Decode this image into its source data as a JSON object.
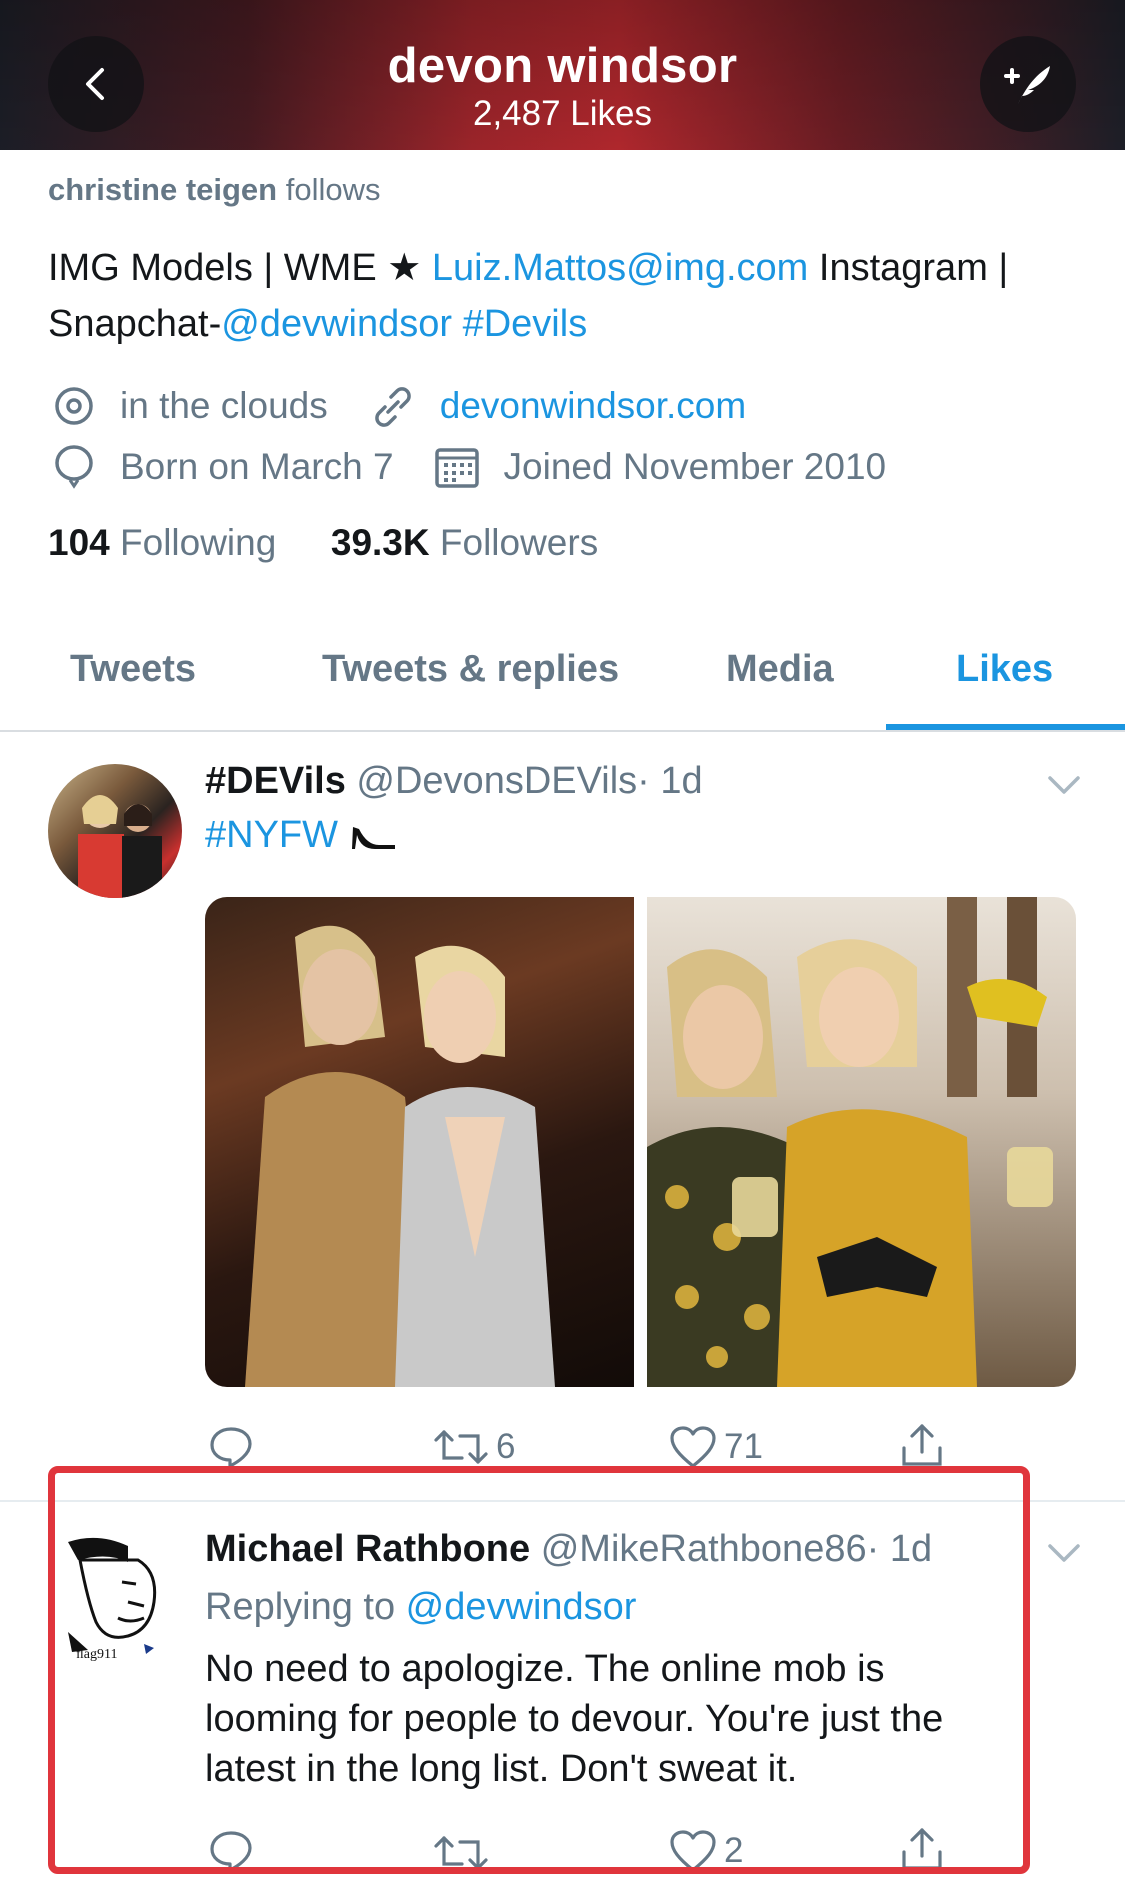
{
  "header": {
    "title": "devon windsor",
    "subtitle": "2,487 Likes"
  },
  "profile": {
    "followed_by_name": "christine teigen",
    "followed_by_suffix": " follows",
    "bio": {
      "part1": "IMG Models | WME ★ ",
      "email": "Luiz.Mattos@img.com",
      "part2": " Instagram | Snapchat-",
      "handle": "@devwindsor",
      "space": " ",
      "hashtag": "#Devils"
    },
    "location": "in the clouds",
    "website": "devonwindsor.com",
    "birthday": "Born on March 7",
    "joined": "Joined November 2010",
    "following_count": "104",
    "following_label": " Following",
    "followers_count": "39.3K",
    "followers_label": " Followers"
  },
  "tabs": [
    {
      "label": "Tweets"
    },
    {
      "label": "Tweets & replies"
    },
    {
      "label": "Media"
    },
    {
      "label": "Likes"
    }
  ],
  "tweets": [
    {
      "name": "#DEVils",
      "handle": "@DevonsDEVils",
      "time": "· 1d",
      "text": "#NYFW",
      "retweets": "6",
      "likes": "71"
    },
    {
      "name": "Michael Rathbone",
      "handle": "@MikeRathbone86",
      "time": "· 1d",
      "reply_prefix": "Replying to ",
      "reply_to": "@devwindsor",
      "text": "No need to apologize. The online mob is looming for people to devour. You're just the latest in the long list. Don't sweat it.",
      "avatar_text": "flag911",
      "likes": "2"
    }
  ],
  "colors": {
    "accent": "#1b95e0",
    "highlight": "#e0353c",
    "muted": "#657786"
  }
}
